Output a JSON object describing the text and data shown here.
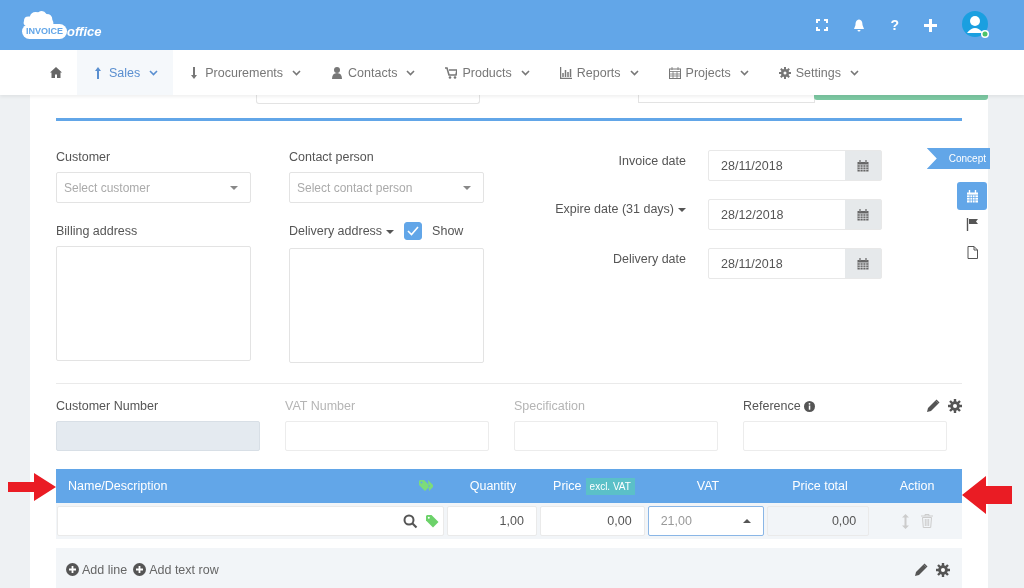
{
  "header": {
    "logo_box": "INVOICE",
    "logo_script": "office",
    "help_icon": "?"
  },
  "nav": [
    {
      "label": "Sales",
      "selected": true
    },
    {
      "label": "Procurements",
      "selected": false
    },
    {
      "label": "Contacts",
      "selected": false
    },
    {
      "label": "Products",
      "selected": false
    },
    {
      "label": "Reports",
      "selected": false
    },
    {
      "label": "Projects",
      "selected": false
    },
    {
      "label": "Settings",
      "selected": false
    }
  ],
  "customer": {
    "label": "Customer",
    "placeholder": "Select customer"
  },
  "contact": {
    "label": "Contact person",
    "placeholder": "Select contact person"
  },
  "billing": {
    "label": "Billing address"
  },
  "delivery": {
    "label": "Delivery address",
    "show": {
      "label": "Show",
      "checked": true
    }
  },
  "dates": [
    {
      "label": "Invoice date",
      "value": "28/11/2018",
      "dropdown": false
    },
    {
      "label": "Expire date (31 days)",
      "value": "28/12/2018",
      "dropdown": true
    },
    {
      "label": "Delivery date",
      "value": "28/11/2018",
      "dropdown": false
    }
  ],
  "status": "Concept",
  "side_tools": [
    {
      "selected": true
    },
    {
      "selected": false
    },
    {
      "selected": false
    }
  ],
  "meta_fields": [
    {
      "label": "Customer Number",
      "disabled": false,
      "readonly": true,
      "info": false
    },
    {
      "label": "VAT Number",
      "disabled": true,
      "readonly": false,
      "info": false
    },
    {
      "label": "Specification",
      "disabled": true,
      "readonly": false,
      "info": false
    },
    {
      "label": "Reference",
      "disabled": false,
      "readonly": false,
      "info": true
    }
  ],
  "table": {
    "columns": [
      {
        "label": "Name/Description"
      },
      {
        "label": "Quantity"
      },
      {
        "label": "Price",
        "badge": "excl. VAT"
      },
      {
        "label": "VAT"
      },
      {
        "label": "Price total"
      },
      {
        "label": "Action"
      }
    ],
    "row": {
      "quantity": "1,00",
      "price": "0,00",
      "vat": "21,00",
      "total": "0,00"
    }
  },
  "footer_actions": [
    "Add line",
    "Add text row"
  ]
}
